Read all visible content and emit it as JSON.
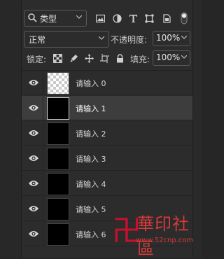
{
  "filter_bar": {
    "kind_label": "类型",
    "filter_icons": [
      "image-filter-icon",
      "adjustment-filter-icon",
      "type-filter-icon",
      "shape-filter-icon",
      "smart-object-filter-icon",
      "filter-toggle-icon"
    ]
  },
  "blend": {
    "mode": "正常",
    "opacity_label": "不透明度:",
    "opacity_value": "100%"
  },
  "lock_row": {
    "lock_label": "锁定:",
    "lock_icons": [
      "lock-transparent-icon",
      "lock-paint-icon",
      "lock-position-icon",
      "lock-artboard-icon",
      "lock-all-icon"
    ],
    "fill_label": "填充:",
    "fill_value": "100%"
  },
  "layers": [
    {
      "name": "请输入 0",
      "thumb": "transparent",
      "selected": false
    },
    {
      "name": "请输入 1",
      "thumb": "black",
      "selected": true
    },
    {
      "name": "请输入 2",
      "thumb": "black",
      "selected": false
    },
    {
      "name": "请输入 3",
      "thumb": "black",
      "selected": false
    },
    {
      "name": "请输入 4",
      "thumb": "black",
      "selected": false
    },
    {
      "name": "请输入 5",
      "thumb": "black",
      "selected": false
    },
    {
      "name": "请输入 6",
      "thumb": "black",
      "selected": false
    }
  ],
  "watermark": {
    "char": "卍",
    "title": "華印社區",
    "url": "www.52cnp.com",
    "color": "#d73a3a"
  },
  "colors": {
    "panel_bg": "#2c2c2c",
    "selected_row_bg": "#3d3d3d",
    "text": "#cfcfcf"
  }
}
